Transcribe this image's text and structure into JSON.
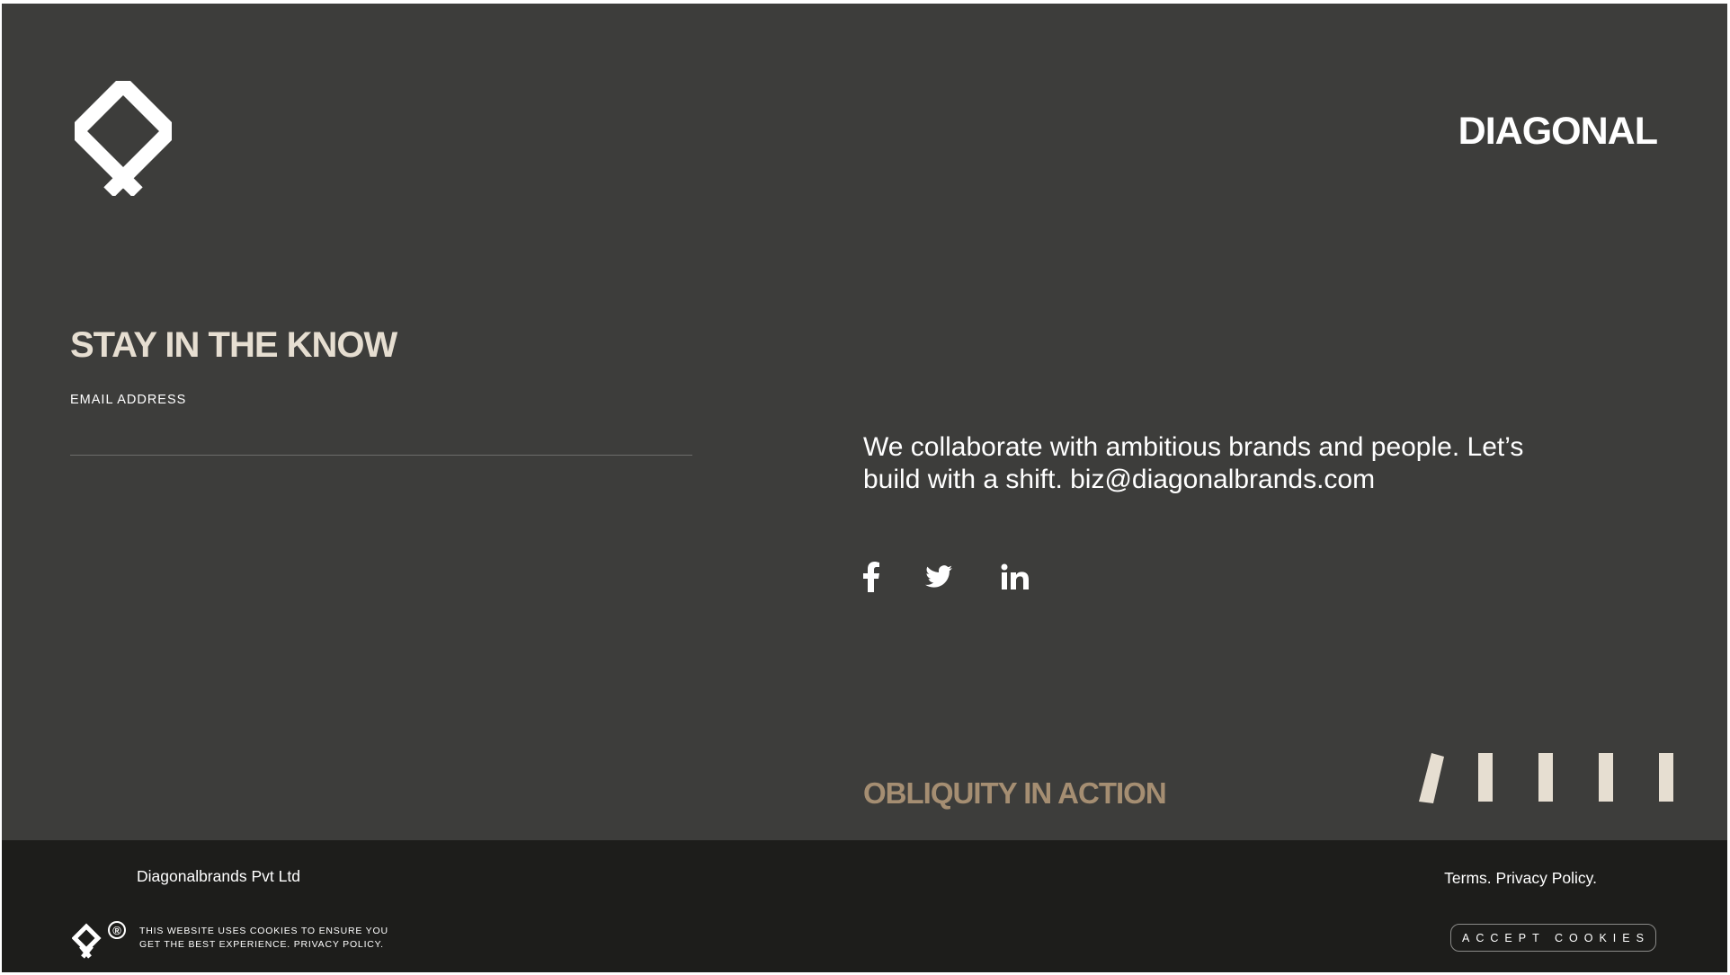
{
  "header": {
    "brand_name": "DIAGONAL",
    "logo_icon": "diagonal-diamond-logo"
  },
  "newsletter": {
    "heading": "STAY IN THE KNOW",
    "email_label": "EMAIL ADDRESS",
    "email_value": ""
  },
  "contact": {
    "tagline_text": "We collaborate with ambitious brands and people. Let’s build with a shift. ",
    "email": "biz@diagonalbrands.com"
  },
  "social": {
    "items": [
      {
        "name": "facebook",
        "icon": "facebook-icon"
      },
      {
        "name": "twitter",
        "icon": "twitter-icon"
      },
      {
        "name": "linkedin",
        "icon": "linkedin-icon"
      }
    ]
  },
  "motto": {
    "text": "OBLIQUITY IN ACTION",
    "accent_color": "#a58e72"
  },
  "footer": {
    "company": "Diagonalbrands Pvt Ltd",
    "terms_label": "Terms.",
    "privacy_label": "Privacy Policy.",
    "cookie_line_1": "THIS WEBSITE USES COOKIES TO ENSURE YOU",
    "cookie_line_2": "GET THE BEST EXPERIENCE. PRIVACY POLICY.",
    "accept_label": "ACCEPT COOKIES",
    "registered_mark": "®"
  },
  "colors": {
    "main_background": "#3d3d3b",
    "footer_background": "#1d1d1b",
    "heading_cream": "#e6ded1",
    "text_white": "#ffffff"
  }
}
